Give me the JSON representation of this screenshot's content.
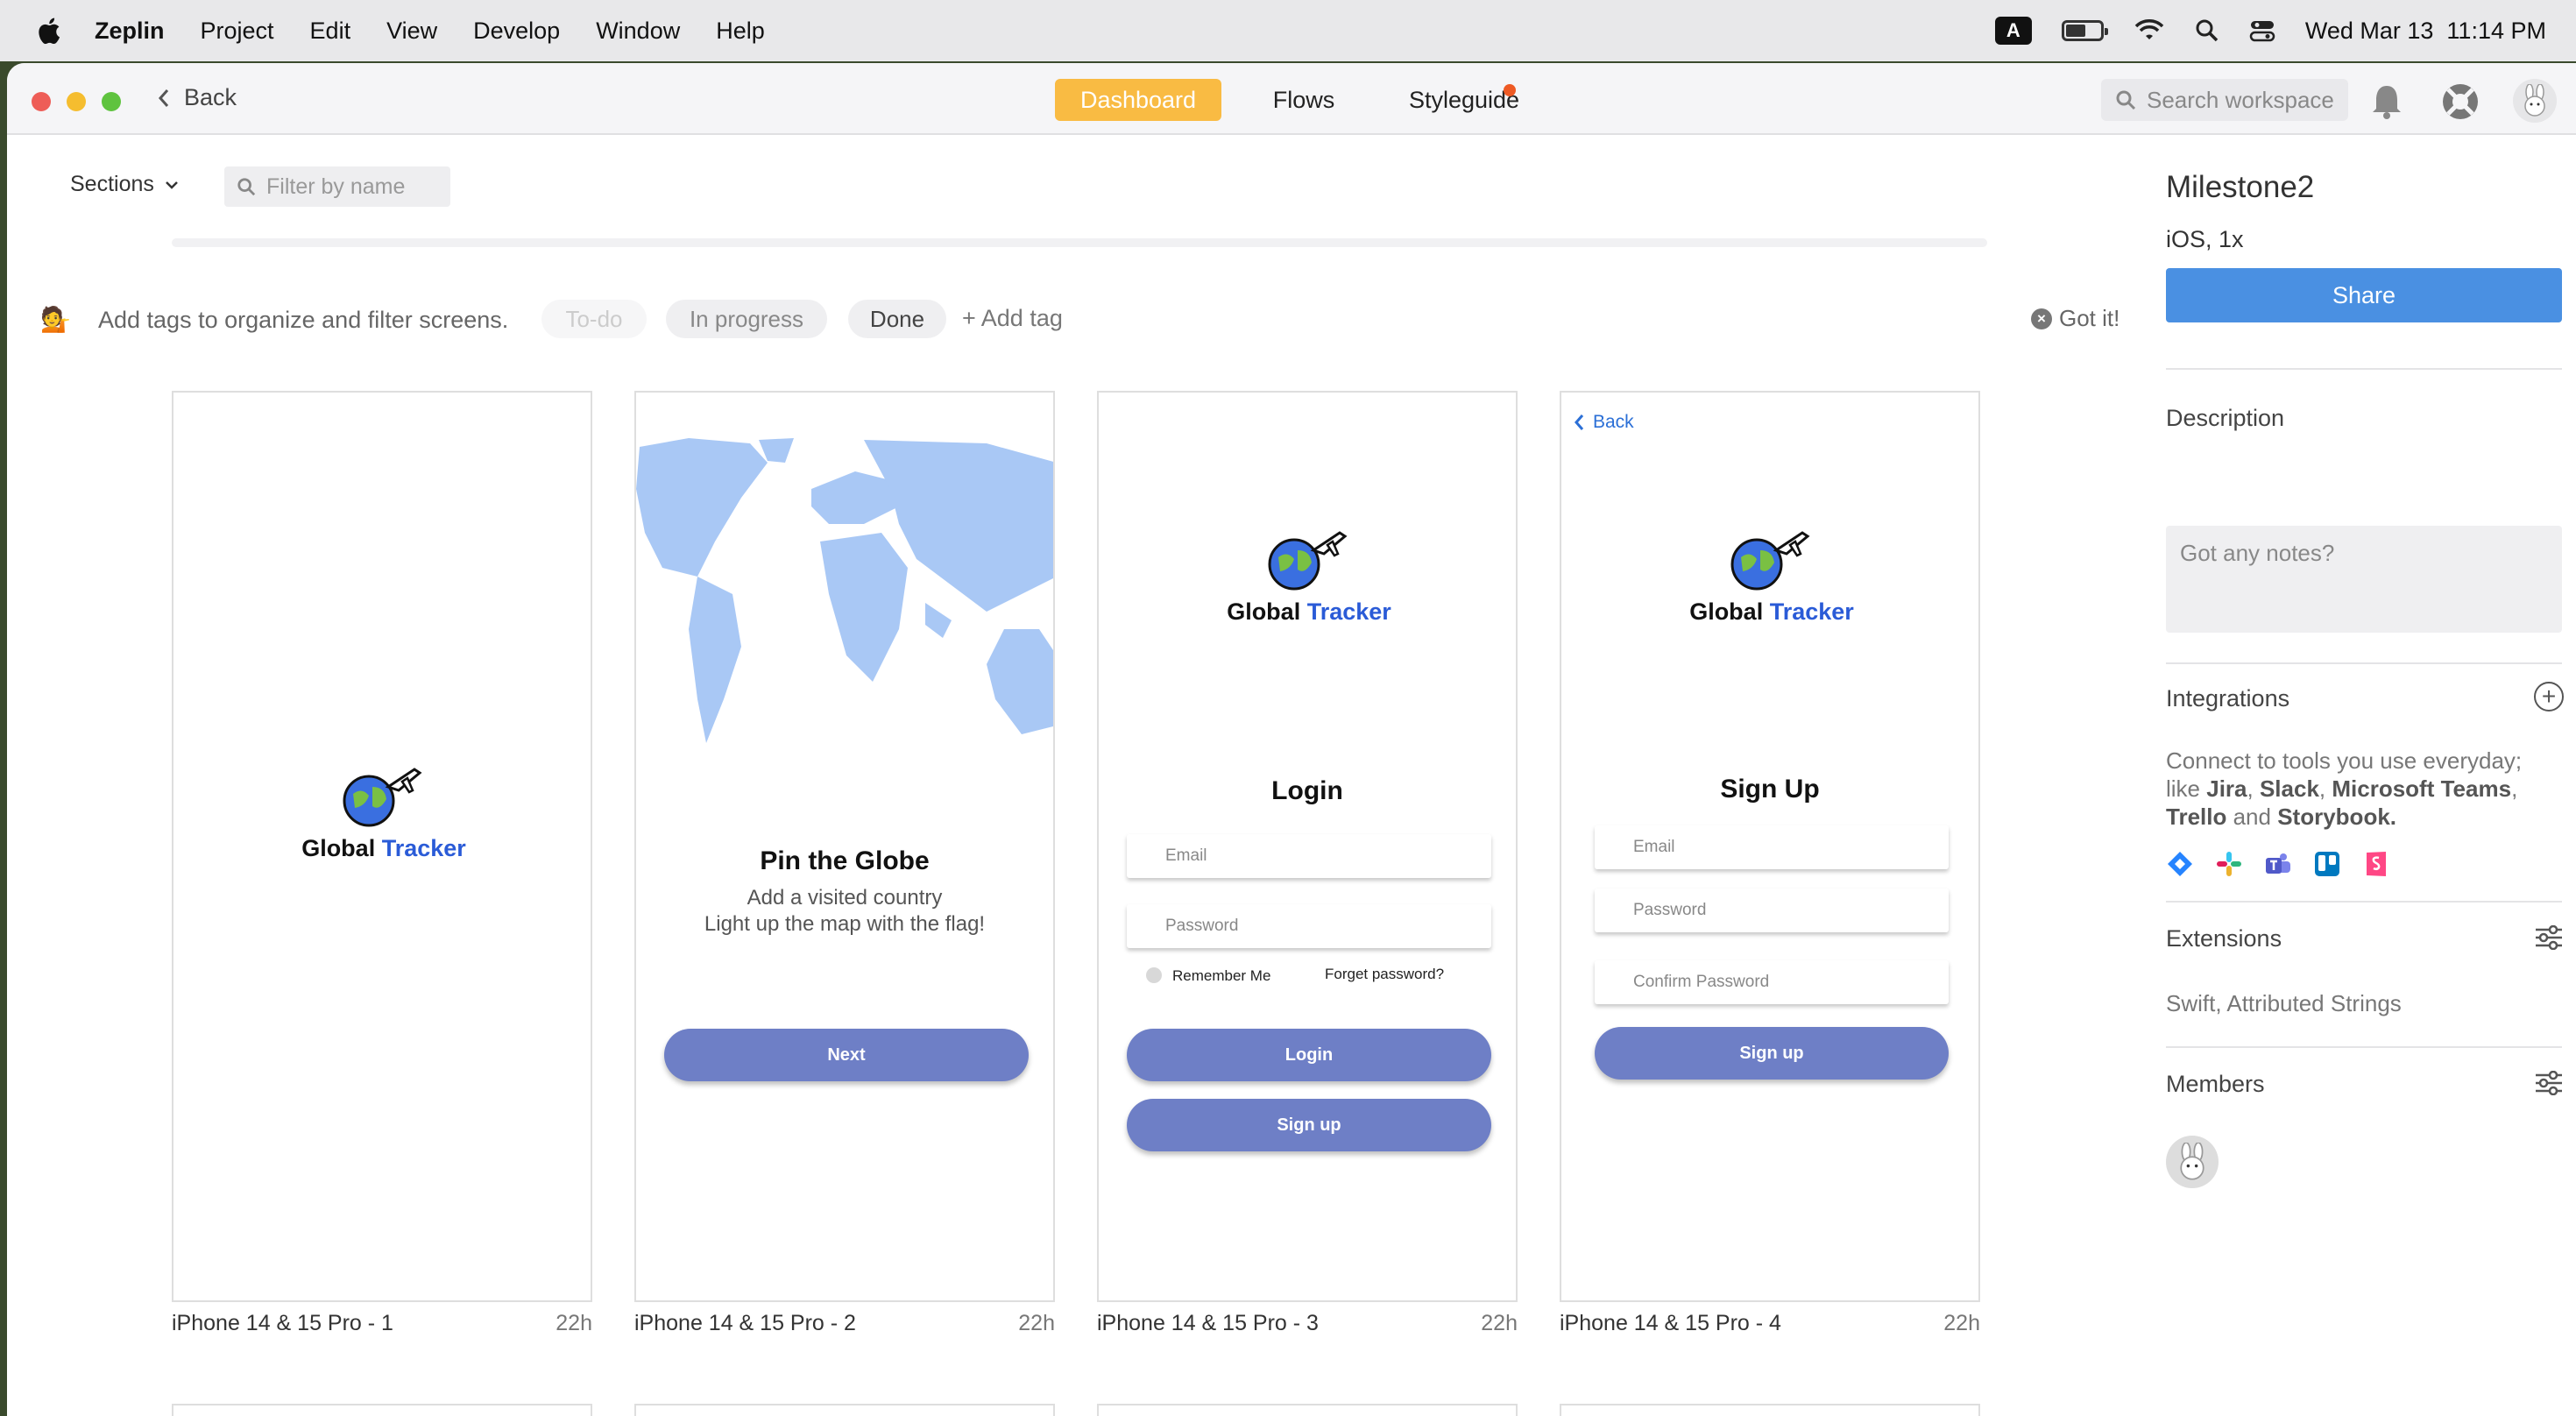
{
  "menubar": {
    "app_name": "Zeplin",
    "items": [
      "Project",
      "Edit",
      "View",
      "Develop",
      "Window",
      "Help"
    ],
    "keyboard_indicator": "A",
    "datetime": "Wed Mar 13  11:14 PM"
  },
  "toolbar": {
    "back_label": "Back",
    "tabs": [
      {
        "label": "Dashboard",
        "active": true
      },
      {
        "label": "Flows",
        "active": false
      },
      {
        "label": "Styleguide",
        "active": false,
        "has_notification": true
      }
    ],
    "search_placeholder": "Search workspace"
  },
  "filter": {
    "sections_label": "Sections",
    "filter_placeholder": "Filter by name"
  },
  "tagbar": {
    "emoji": "💁",
    "hint": "Add tags to organize and filter screens.",
    "tags": [
      "To-do",
      "In progress",
      "Done"
    ],
    "add_tag_label": "Add tag",
    "dismiss_label": "Got it!"
  },
  "screens": [
    {
      "name": "iPhone 14 & 15 Pro - 1",
      "time": "22h",
      "logo_word1": "Global",
      "logo_word2": "Tracker"
    },
    {
      "name": "iPhone 14 & 15 Pro - 2",
      "time": "22h",
      "title": "Pin the Globe",
      "line1": "Add a visited country",
      "line2": "Light up the map with the flag!",
      "button": "Next"
    },
    {
      "name": "iPhone 14 & 15 Pro - 3",
      "time": "22h",
      "logo_word1": "Global",
      "logo_word2": "Tracker",
      "title": "Login",
      "email": "Email",
      "password": "Password",
      "remember": "Remember Me",
      "forgot": "Forget password?",
      "button1": "Login",
      "button2": "Sign up"
    },
    {
      "name": "iPhone 14 & 15 Pro - 4",
      "time": "22h",
      "back": "Back",
      "logo_word1": "Global",
      "logo_word2": "Tracker",
      "title": "Sign Up",
      "email": "Email",
      "password": "Password",
      "confirm": "Confirm Password",
      "button": "Sign up"
    }
  ],
  "panel": {
    "title": "Milestone2",
    "platform": "iOS, 1x",
    "share_label": "Share",
    "description_title": "Description",
    "notes_placeholder": "Got any notes?",
    "integrations_title": "Integrations",
    "integrations_line1": "Connect to tools you use everyday;",
    "integrations_like": "like",
    "integrations_jira": "Jira",
    "integrations_slack": "Slack",
    "integrations_teams": "Microsoft Teams",
    "integrations_trello": "Trello",
    "integrations_and": "and",
    "integrations_storybook": "Storybook.",
    "extensions_title": "Extensions",
    "extensions_value": "Swift, Attributed Strings",
    "members_title": "Members"
  },
  "colors": {
    "accent_tab": "#f9bb43",
    "share_button": "#4a90e2",
    "app_button": "#6e7fc6",
    "logo_accent": "#2a5bd7",
    "map": "#a9c8f5"
  }
}
